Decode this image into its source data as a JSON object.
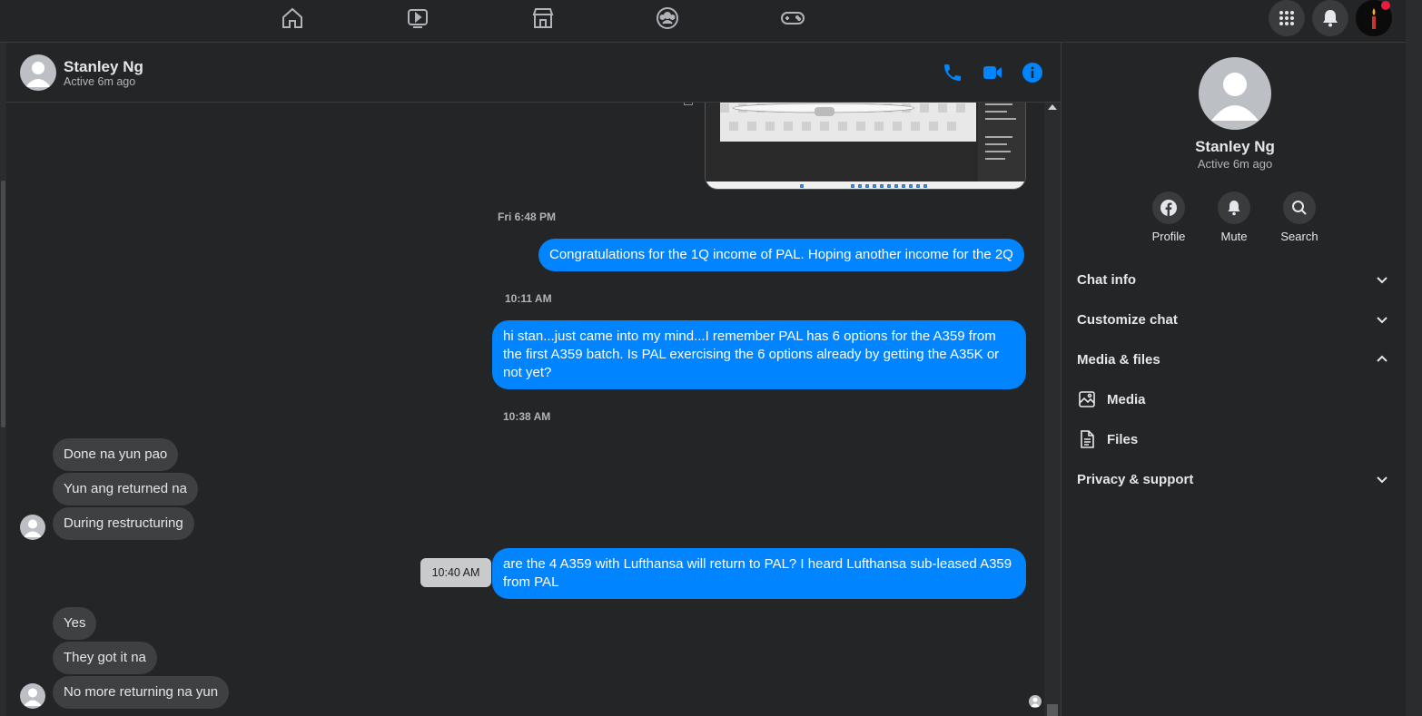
{
  "top_nav": {
    "items": [
      "home-icon",
      "watch-icon",
      "marketplace-icon",
      "groups-icon",
      "gaming-icon"
    ],
    "right": [
      "menu-icon",
      "notifications-icon",
      "account-avatar"
    ]
  },
  "contact": {
    "name": "Stanley Ng",
    "status": "Active 6m ago"
  },
  "header_actions": [
    "phone-icon",
    "video-icon",
    "info-icon"
  ],
  "messages": {
    "ts1": "Fri 6:48 PM",
    "m1": "Congratulations for the 1Q income of PAL. Hoping another income for the 2Q",
    "ts2": "10:11 AM",
    "m2": "hi stan...just came into my mind...I remember PAL has 6 options for the A359 from the first A359 batch. Is PAL exercising the 6 options already by getting the A35K or not yet?",
    "ts3": "10:38 AM",
    "in1": "Done na yun pao",
    "in2": "Yun ang returned na",
    "in3": "During restructuring",
    "tooltip": "10:40 AM",
    "m3": "are the 4 A359 with Lufthansa will return to PAL? I heard Lufthansa sub-leased A359 from PAL",
    "in4": "Yes",
    "in5": "They got it na",
    "in6": "No more returning na yun"
  },
  "right_panel": {
    "name": "Stanley Ng",
    "status": "Active 6m ago",
    "actions": {
      "profile": "Profile",
      "mute": "Mute",
      "search": "Search"
    },
    "sections": {
      "chat_info": "Chat info",
      "customize": "Customize chat",
      "media_files": "Media & files",
      "media": "Media",
      "files": "Files",
      "privacy": "Privacy & support"
    }
  },
  "colors": {
    "accent": "#0084ff",
    "background": "#242526",
    "incoming_bubble": "#3e4042",
    "notification": "#e41e3f"
  }
}
